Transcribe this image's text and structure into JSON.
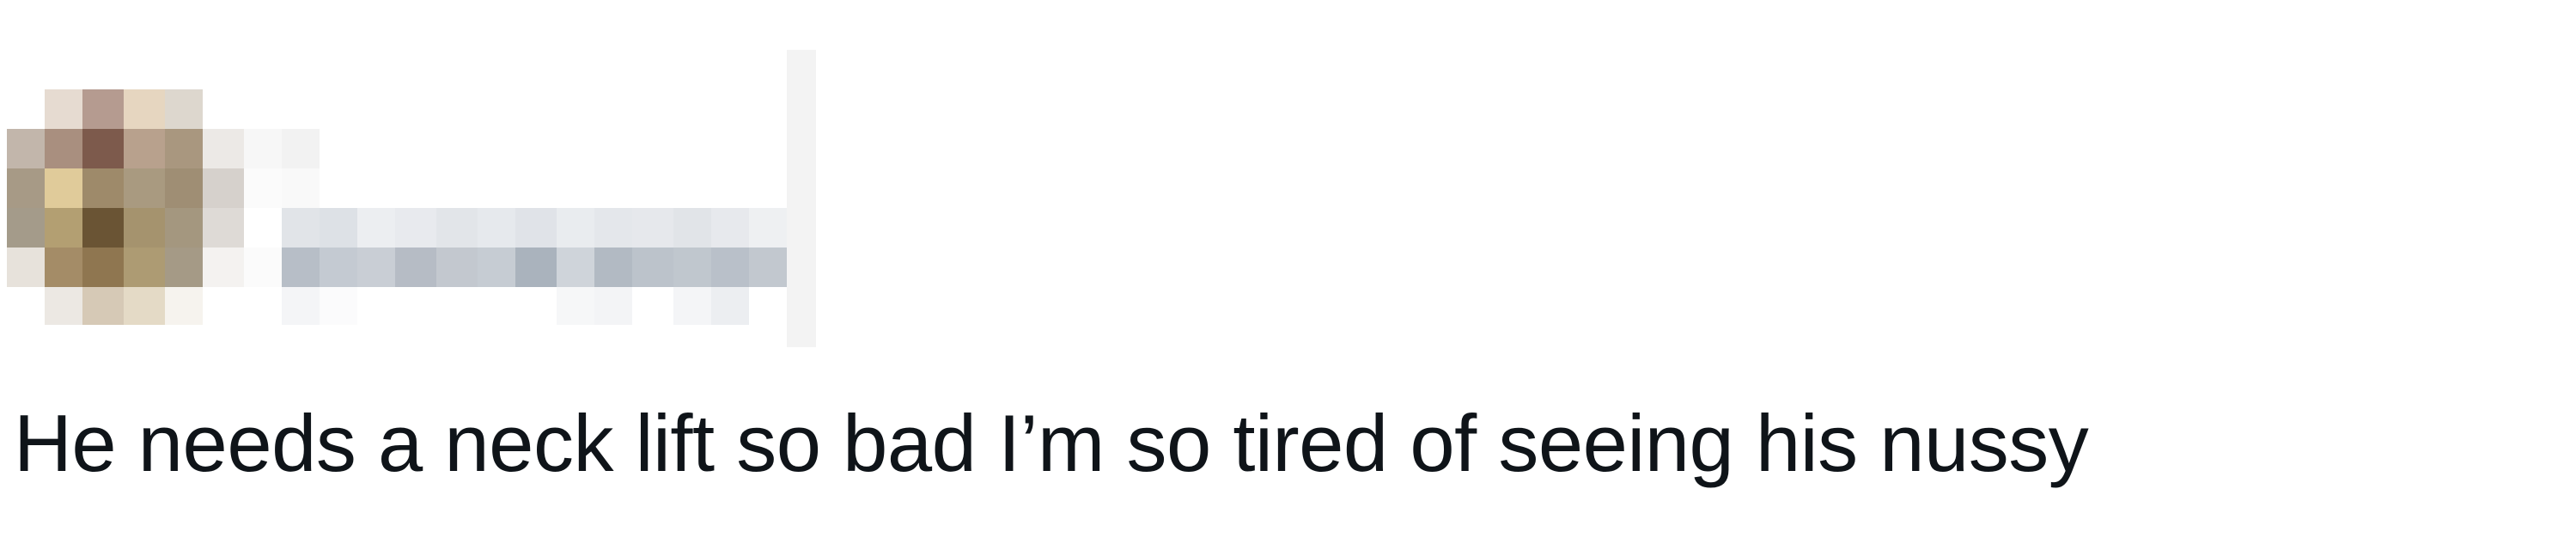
{
  "tweet": {
    "author": {
      "display_name": "",
      "handle": "",
      "avatar_icon": "avatar-pixelated",
      "redacted": true
    },
    "text": "He needs a neck lift so bad I’m so tired of seeing his nussy"
  },
  "colors": {
    "background": "#ffffff",
    "text": "#0f1419",
    "redaction_gray": "#bac1c9"
  }
}
